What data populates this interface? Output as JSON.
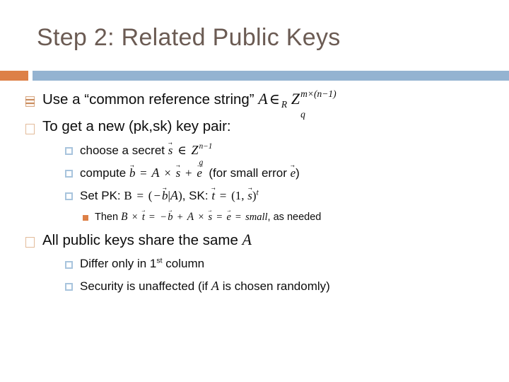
{
  "slide": {
    "title": "Step 2: Related Public Keys",
    "title_color": "#6b5b53",
    "background_color": "#ffffff",
    "accent_orange": "#dd8047",
    "accent_blue": "#94b3d1",
    "bullet_level1_color": "#d8a984",
    "bullet_level2_color": "#a8c4dd",
    "bullet_level3_color": "#dd8047",
    "body_text_color": "#0d0d0d"
  },
  "bullets": {
    "b1": {
      "level": 1,
      "marker": "segmented-square-bullet",
      "text_before": "Use a “common reference string”",
      "math": {
        "A": "A",
        "in_r": "∈",
        "in_r_sub": "R",
        "Z": "Z",
        "Z_sub": "q",
        "Z_sup": "m×(n−1)"
      },
      "plain": "Use a “common reference string” A ∈R Zq^(m×(n−1))"
    },
    "b2": {
      "level": 1,
      "marker": "hollow-square-bullet",
      "text": "To get a new (pk,sk) key pair:"
    },
    "b3": {
      "level": 2,
      "marker": "blue-square-bullet",
      "text_before": "choose a secret",
      "math": {
        "s": "s",
        "in": "∈",
        "Z": "Z",
        "Z_sub": "q",
        "Z_sup": "n−1"
      },
      "plain": "choose a secret ⃗s ∈ Zq^(n−1)"
    },
    "b4": {
      "level": 2,
      "marker": "blue-square-bullet",
      "text_before": "compute",
      "text_after": "(for small error",
      "text_close": ")",
      "math": {
        "b": "b",
        "eq": "=",
        "A": "A",
        "times": "×",
        "s": "s",
        "plus": "+",
        "e": "e"
      },
      "plain": "compute ⃗b = A × ⃗s + ⃗e  (for small error ⃗e)"
    },
    "b5": {
      "level": 2,
      "marker": "blue-square-bullet",
      "label_pk": "Set PK:",
      "label_sk": ", SK:",
      "math": {
        "B": "B",
        "eq": "=",
        "open": "(",
        "minus": "−",
        "b": "b",
        "bar": "|",
        "A": "A",
        "close": ")",
        "t": "t",
        "eq2": "=",
        "one": "1",
        "comma": ",",
        "s": "s",
        "sup_t": "t"
      },
      "plain": "Set PK: B = (−⃗b|A), SK: ⃗t = (1, ⃗s)^t"
    },
    "b6": {
      "level": 3,
      "marker": "orange-square-bullet",
      "text_before": "Then",
      "text_after": ", as needed",
      "math": {
        "B": "B",
        "times": "×",
        "t": "t",
        "eq": "=",
        "minus": "−",
        "b": "b",
        "plus": "+",
        "A": "A",
        "times2": "×",
        "s": "s",
        "eq2": "=",
        "e": "e",
        "eq3": "=",
        "small": "small"
      },
      "plain": "Then B × ⃗t = −⃗b + A × ⃗s = ⃗e = small, as needed"
    },
    "b7": {
      "level": 1,
      "marker": "hollow-square-bullet",
      "text_before": "All public keys share the same",
      "math": {
        "A": "A"
      },
      "plain": "All public keys share the same A"
    },
    "b8": {
      "level": 2,
      "marker": "blue-square-bullet",
      "text_before": "Differ only in 1",
      "ordinal": "st",
      "text_after": " column",
      "plain": "Differ only in 1st column"
    },
    "b9": {
      "level": 2,
      "marker": "blue-square-bullet",
      "text_before": "Security is unaffected (if",
      "text_after": "is chosen randomly)",
      "math": {
        "A": "A"
      },
      "plain": "Security is unaffected (if A is chosen randomly)"
    }
  }
}
